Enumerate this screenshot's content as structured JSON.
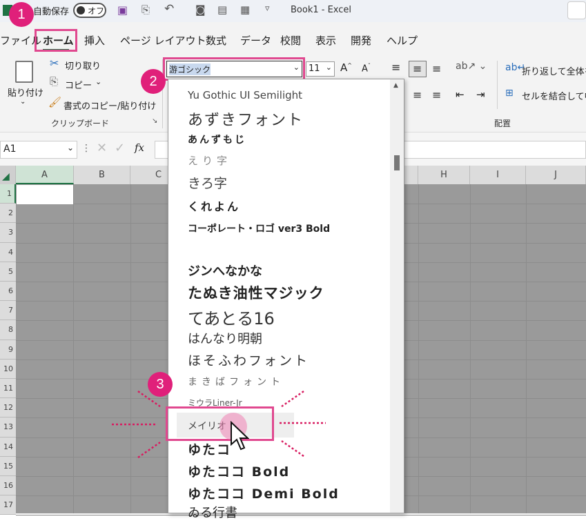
{
  "titlebar": {
    "autosave": "自動保存",
    "toggle": "オフ",
    "filename": "Book1  -  Excel"
  },
  "tabs": [
    "ファイル",
    "ホーム",
    "挿入",
    "ページ レイアウト",
    "数式",
    "データ",
    "校閲",
    "表示",
    "開発",
    "ヘルプ"
  ],
  "clipboard": {
    "paste": "貼り付け",
    "cut": "切り取り",
    "copy": "コピー",
    "format_painter": "書式のコピー/貼り付け",
    "group": "クリップボード"
  },
  "font": {
    "name": "游ゴシック",
    "size": "11"
  },
  "alignment": {
    "wrap": "折り返して全体を",
    "merge": "セルを結合して中",
    "group": "配置"
  },
  "formula": {
    "namebox": "A1",
    "fx": "fx"
  },
  "columns": [
    "A",
    "B",
    "C",
    "H",
    "I",
    "J"
  ],
  "rows": [
    "1",
    "2",
    "3",
    "4",
    "5",
    "6",
    "7",
    "8",
    "9",
    "10",
    "11",
    "12",
    "13",
    "14",
    "15",
    "16",
    "17"
  ],
  "fonts": [
    "Yu Gothic UI Semilight",
    "あずきフォント",
    "あんずもじ",
    "えり字",
    "きろ字",
    "くれよん",
    "コーポレート・ロゴ ver3 Bold",
    "ジンへなかな",
    "たぬき油性マジック",
    "てあとる16",
    "はんなり明朝",
    "ほそふわフォント",
    "まきばフォント",
    "ミウラLiner-Jr",
    "メイリオ",
    "ゆたコ",
    "ゆたココ Bold",
    "ゆたココ Demi Bold",
    "ゐる行書"
  ],
  "badges": [
    "1",
    "2",
    "3"
  ],
  "colors": {
    "accent": "#e0207a",
    "excel_green": "#1f7244"
  }
}
